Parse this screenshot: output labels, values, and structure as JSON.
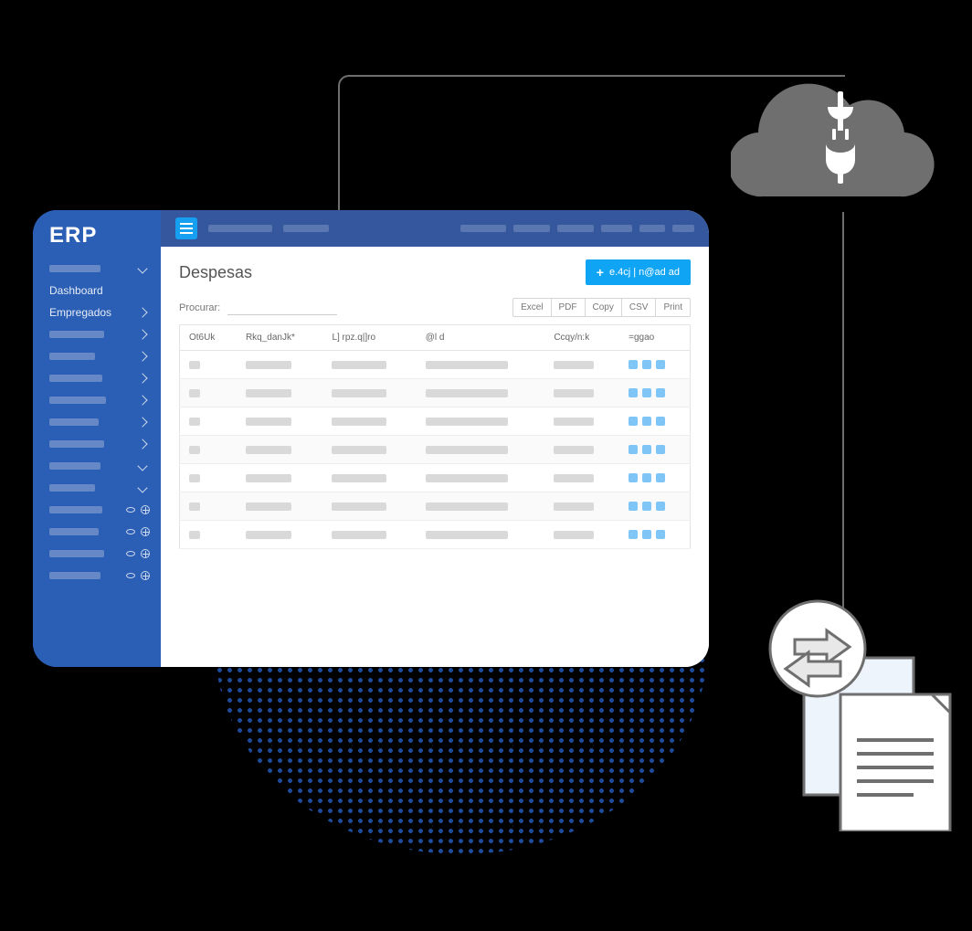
{
  "brand": "ERP",
  "sidebar": {
    "items": [
      {
        "label": "",
        "placeholder": true,
        "width": 56,
        "chevron": "down"
      },
      {
        "label": "Dashboard"
      },
      {
        "label": "Empregados",
        "chevron": "right"
      },
      {
        "label": "",
        "placeholder": true,
        "width": 60,
        "chevron": "right"
      },
      {
        "label": "",
        "placeholder": true,
        "width": 50,
        "chevron": "right"
      },
      {
        "label": "",
        "placeholder": true,
        "width": 58,
        "chevron": "right"
      },
      {
        "label": "",
        "placeholder": true,
        "width": 62,
        "chevron": "right"
      },
      {
        "label": "",
        "placeholder": true,
        "width": 54,
        "chevron": "right"
      },
      {
        "label": "",
        "placeholder": true,
        "width": 60,
        "chevron": "right"
      },
      {
        "label": "",
        "placeholder": true,
        "width": 56,
        "chevron": "down"
      },
      {
        "label": "",
        "placeholder": true,
        "width": 50,
        "chevron": "down"
      },
      {
        "label": "",
        "placeholder": true,
        "width": 58,
        "icons": true
      },
      {
        "label": "",
        "placeholder": true,
        "width": 54,
        "icons": true
      },
      {
        "label": "",
        "placeholder": true,
        "width": 60,
        "icons": true
      },
      {
        "label": "",
        "placeholder": true,
        "width": 56,
        "icons": true
      }
    ]
  },
  "page": {
    "title": "Despesas",
    "primary_button": "e.4cj | n@ad ad",
    "search_label": "Procurar:",
    "export_buttons": [
      "Excel",
      "PDF",
      "Copy",
      "CSV",
      "Print"
    ],
    "columns": [
      "Ot6Uk",
      "Rkq_danJk*",
      "L] rpz.q|]ro",
      "@l d",
      "Ccqy/n:k",
      "=ggao"
    ],
    "rows": 7
  }
}
